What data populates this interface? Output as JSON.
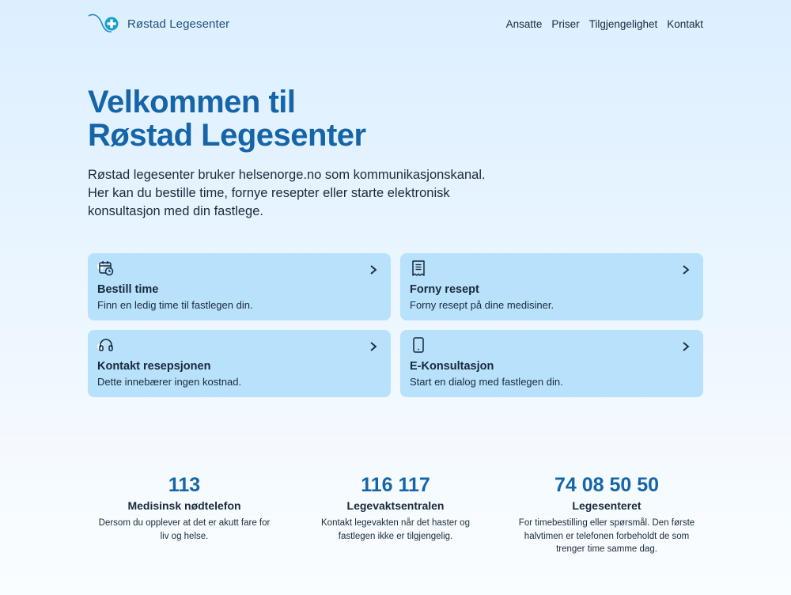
{
  "header": {
    "brand_name": "Røstad Legesenter",
    "nav": [
      "Ansatte",
      "Priser",
      "Tilgjengelighet",
      "Kontakt"
    ]
  },
  "hero": {
    "title_line1": "Velkommen til",
    "title_line2": "Røstad Legesenter",
    "intro": "Røstad legesenter bruker helsenorge.no som kommunikasjonskanal. Her kan du bestille time, fornye resepter eller starte elektronisk konsultasjon med din fastlege."
  },
  "cards": [
    {
      "icon": "calendar-clock-icon",
      "title": "Bestill time",
      "desc": "Finn en ledig time til fastlegen din."
    },
    {
      "icon": "receipt-icon",
      "title": "Forny resept",
      "desc": "Forny resept på dine medisiner."
    },
    {
      "icon": "headset-icon",
      "title": "Kontakt resepsjonen",
      "desc": "Dette innebærer ingen kostnad."
    },
    {
      "icon": "tablet-icon",
      "title": "E-Konsultasjon",
      "desc": "Start en dialog med fastlegen din."
    }
  ],
  "stats": [
    {
      "number": "113",
      "label": "Medisinsk nødtelefon",
      "desc": "Dersom du opplever at det er akutt fare for liv og helse."
    },
    {
      "number": "116 117",
      "label": "Legevaktsentralen",
      "desc": "Kontakt legevakten når det haster og fastlegen ikke er tilgjengelig."
    },
    {
      "number": "74 08 50 50",
      "label": "Legesenteret",
      "desc": "For timebestilling eller spørsmål. Den første halvtimen er telefonen forbeholdt de som trenger time samme dag."
    }
  ],
  "colors": {
    "accent": "#1565a8",
    "card_bg": "#b8e1fb",
    "logo": "#1a9fd0"
  }
}
